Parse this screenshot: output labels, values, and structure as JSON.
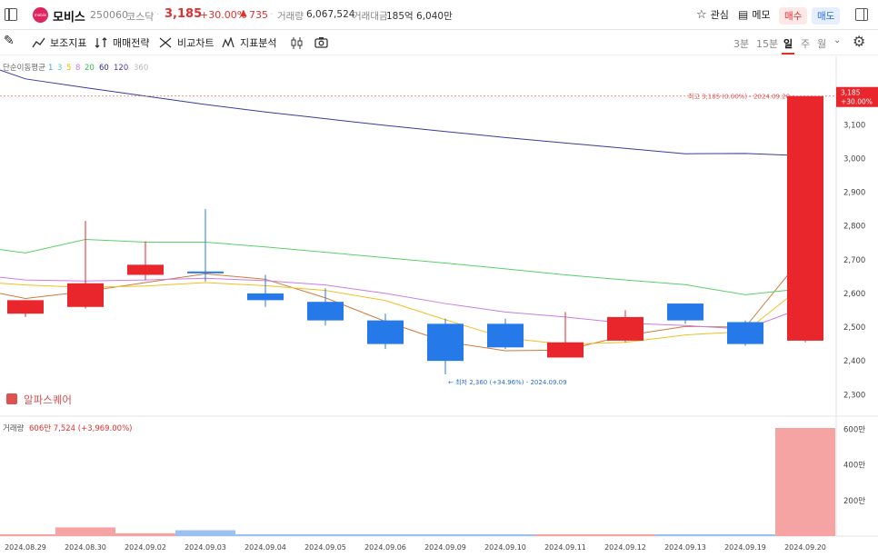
{
  "header": {
    "stock_name": "모비스",
    "stock_code": "250060",
    "market": "코스닥",
    "price": "3,185",
    "change_pct": "+30.00%",
    "change_amt": "735",
    "volume_label": "거래량",
    "volume": "6,067,524",
    "amount_label": "거래대금",
    "amount": "185억 6,040만",
    "logo_text": "mobiis",
    "watch_label": "관심",
    "memo_label": "메모",
    "buy_label": "매수",
    "sell_label": "매도"
  },
  "toolbar": {
    "tools": [
      "보조지표",
      "매매전략",
      "비교차트",
      "지표분석"
    ],
    "periods": [
      "3분",
      "15분",
      "일",
      "주",
      "월"
    ],
    "active_period": "일"
  },
  "indicator": {
    "label": "단순이동평균",
    "periods": [
      "1",
      "3",
      "5",
      "8",
      "20",
      "60",
      "120",
      "360"
    ],
    "colors": [
      "#3aa0ff",
      "#4dd0c4",
      "#f5b800",
      "#c97de8",
      "#32c24d",
      "#2a2f8f",
      "#4a3aa8",
      "#bbbbbb"
    ]
  },
  "brand": "알파스퀘어",
  "chart_data": {
    "type": "candlestick",
    "dates": [
      "2024.08.29",
      "2024.08.30",
      "2024.09.02",
      "2024.09.03",
      "2024.09.04",
      "2024.09.05",
      "2024.09.06",
      "2024.09.09",
      "2024.09.10",
      "2024.09.11",
      "2024.09.12",
      "2024.09.13",
      "2024.09.19",
      "2024.09.20"
    ],
    "ohlc": [
      [
        2540,
        2580,
        2530,
        2580
      ],
      [
        2560,
        2815,
        2555,
        2630
      ],
      [
        2655,
        2755,
        2640,
        2685
      ],
      [
        2665,
        2850,
        2635,
        2660
      ],
      [
        2600,
        2655,
        2560,
        2580
      ],
      [
        2575,
        2615,
        2505,
        2520
      ],
      [
        2520,
        2540,
        2435,
        2450
      ],
      [
        2510,
        2525,
        2360,
        2400
      ],
      [
        2510,
        2525,
        2435,
        2440
      ],
      [
        2410,
        2545,
        2410,
        2455
      ],
      [
        2460,
        2550,
        2455,
        2530
      ],
      [
        2570,
        2570,
        2510,
        2520
      ],
      [
        2515,
        2520,
        2445,
        2450
      ],
      [
        2460,
        3185,
        2455,
        3185
      ]
    ],
    "ma": [
      {
        "name": "3",
        "values": [
          2585,
          2606,
          2632,
          2658,
          2642,
          2587,
          2517,
          2457,
          2430,
          2432,
          2475,
          2502,
          2500,
          2718
        ]
      },
      {
        "name": "5",
        "values": [
          2625,
          2618,
          2622,
          2632,
          2623,
          2609,
          2579,
          2522,
          2468,
          2449,
          2455,
          2477,
          2487,
          2628
        ]
      },
      {
        "name": "8",
        "values": [
          2640,
          2637,
          2640,
          2645,
          2638,
          2625,
          2600,
          2570,
          2545,
          2530,
          2512,
          2505,
          2494,
          2560
        ]
      },
      {
        "name": "20",
        "values": [
          2720,
          2760,
          2752,
          2752,
          2738,
          2722,
          2706,
          2690,
          2673,
          2655,
          2640,
          2626,
          2596,
          2615
        ]
      },
      {
        "name": "120",
        "values": [
          3236,
          3210,
          3185,
          3160,
          3138,
          3118,
          3098,
          3080,
          3062,
          3046,
          3030,
          3014,
          3015,
          3008
        ]
      }
    ],
    "y_ticks": [
      "3,100",
      "3,000",
      "2,900",
      "2,800",
      "2,700",
      "2,600",
      "2,500",
      "2,400",
      "2,300"
    ],
    "ylim": [
      2300,
      3100
    ],
    "max_note": "최고 3,185 (0.00%) - 2024.09.20",
    "min_note": "최저 2,360 (+34.96%) - 2024.09.09",
    "last_price": "3,185",
    "last_pct": "+30.00%",
    "volume": {
      "label": "거래량",
      "value_text": "606만 7,524 (+3,969.00%)",
      "values": [
        4.5,
        49,
        16,
        33,
        2.5,
        3,
        1.5,
        4,
        1,
        1.5,
        2,
        1,
        2,
        606.75
      ],
      "y_ticks": [
        "600만",
        "400만",
        "200만"
      ]
    }
  }
}
